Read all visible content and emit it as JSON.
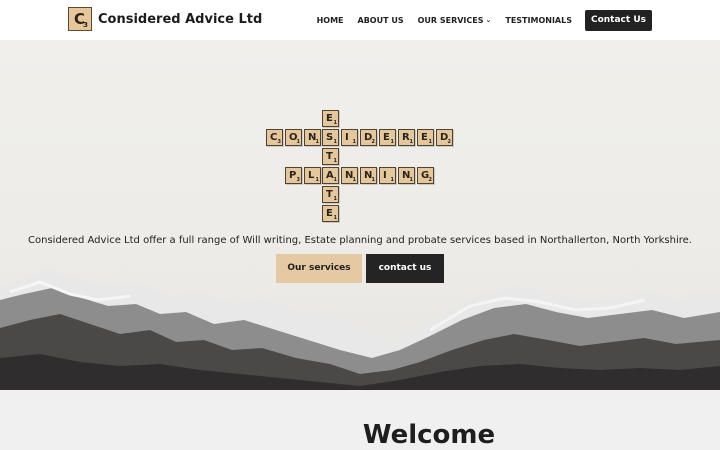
{
  "brand": {
    "logo_letter": "C",
    "logo_score": "3",
    "name": "Considered Advice Ltd"
  },
  "nav": {
    "items": [
      "HOME",
      "ABOUT US",
      "OUR SERVICES",
      "TESTIMONIALS"
    ],
    "contact_label": "Contact Us"
  },
  "hero": {
    "tiles": {
      "considered": [
        {
          "letter": "C",
          "score": "3"
        },
        {
          "letter": "O",
          "score": "1"
        },
        {
          "letter": "N",
          "score": "1"
        },
        {
          "letter": "S",
          "score": "1"
        },
        {
          "letter": "I",
          "score": "1"
        },
        {
          "letter": "D",
          "score": "2"
        },
        {
          "letter": "E",
          "score": "1"
        },
        {
          "letter": "R",
          "score": "1"
        },
        {
          "letter": "E",
          "score": "1"
        },
        {
          "letter": "D",
          "score": "2"
        }
      ],
      "planning": [
        {
          "letter": "P",
          "score": "3"
        },
        {
          "letter": "L",
          "score": "1"
        },
        {
          "letter": "A",
          "score": "1"
        },
        {
          "letter": "N",
          "score": "1"
        },
        {
          "letter": "N",
          "score": "1"
        },
        {
          "letter": "I",
          "score": "1"
        },
        {
          "letter": "N",
          "score": "1"
        },
        {
          "letter": "G",
          "score": "2"
        }
      ],
      "estate": [
        {
          "letter": "E",
          "score": "1"
        },
        {
          "letter": "S",
          "score": "1"
        },
        {
          "letter": "T",
          "score": "1"
        },
        {
          "letter": "A",
          "score": "1"
        },
        {
          "letter": "T",
          "score": "1"
        },
        {
          "letter": "E",
          "score": "1"
        }
      ]
    },
    "tagline": "Considered Advice Ltd offer a full range of Will writing, Estate planning and probate services based in Northallerton, North Yorkshire.",
    "primary_button": "Our services",
    "secondary_button": "contact us"
  },
  "welcome": {
    "title": "Welcome"
  },
  "colors": {
    "tile": "#e5c79c",
    "accent_button": "#e4c9a3",
    "dark": "#222222"
  }
}
